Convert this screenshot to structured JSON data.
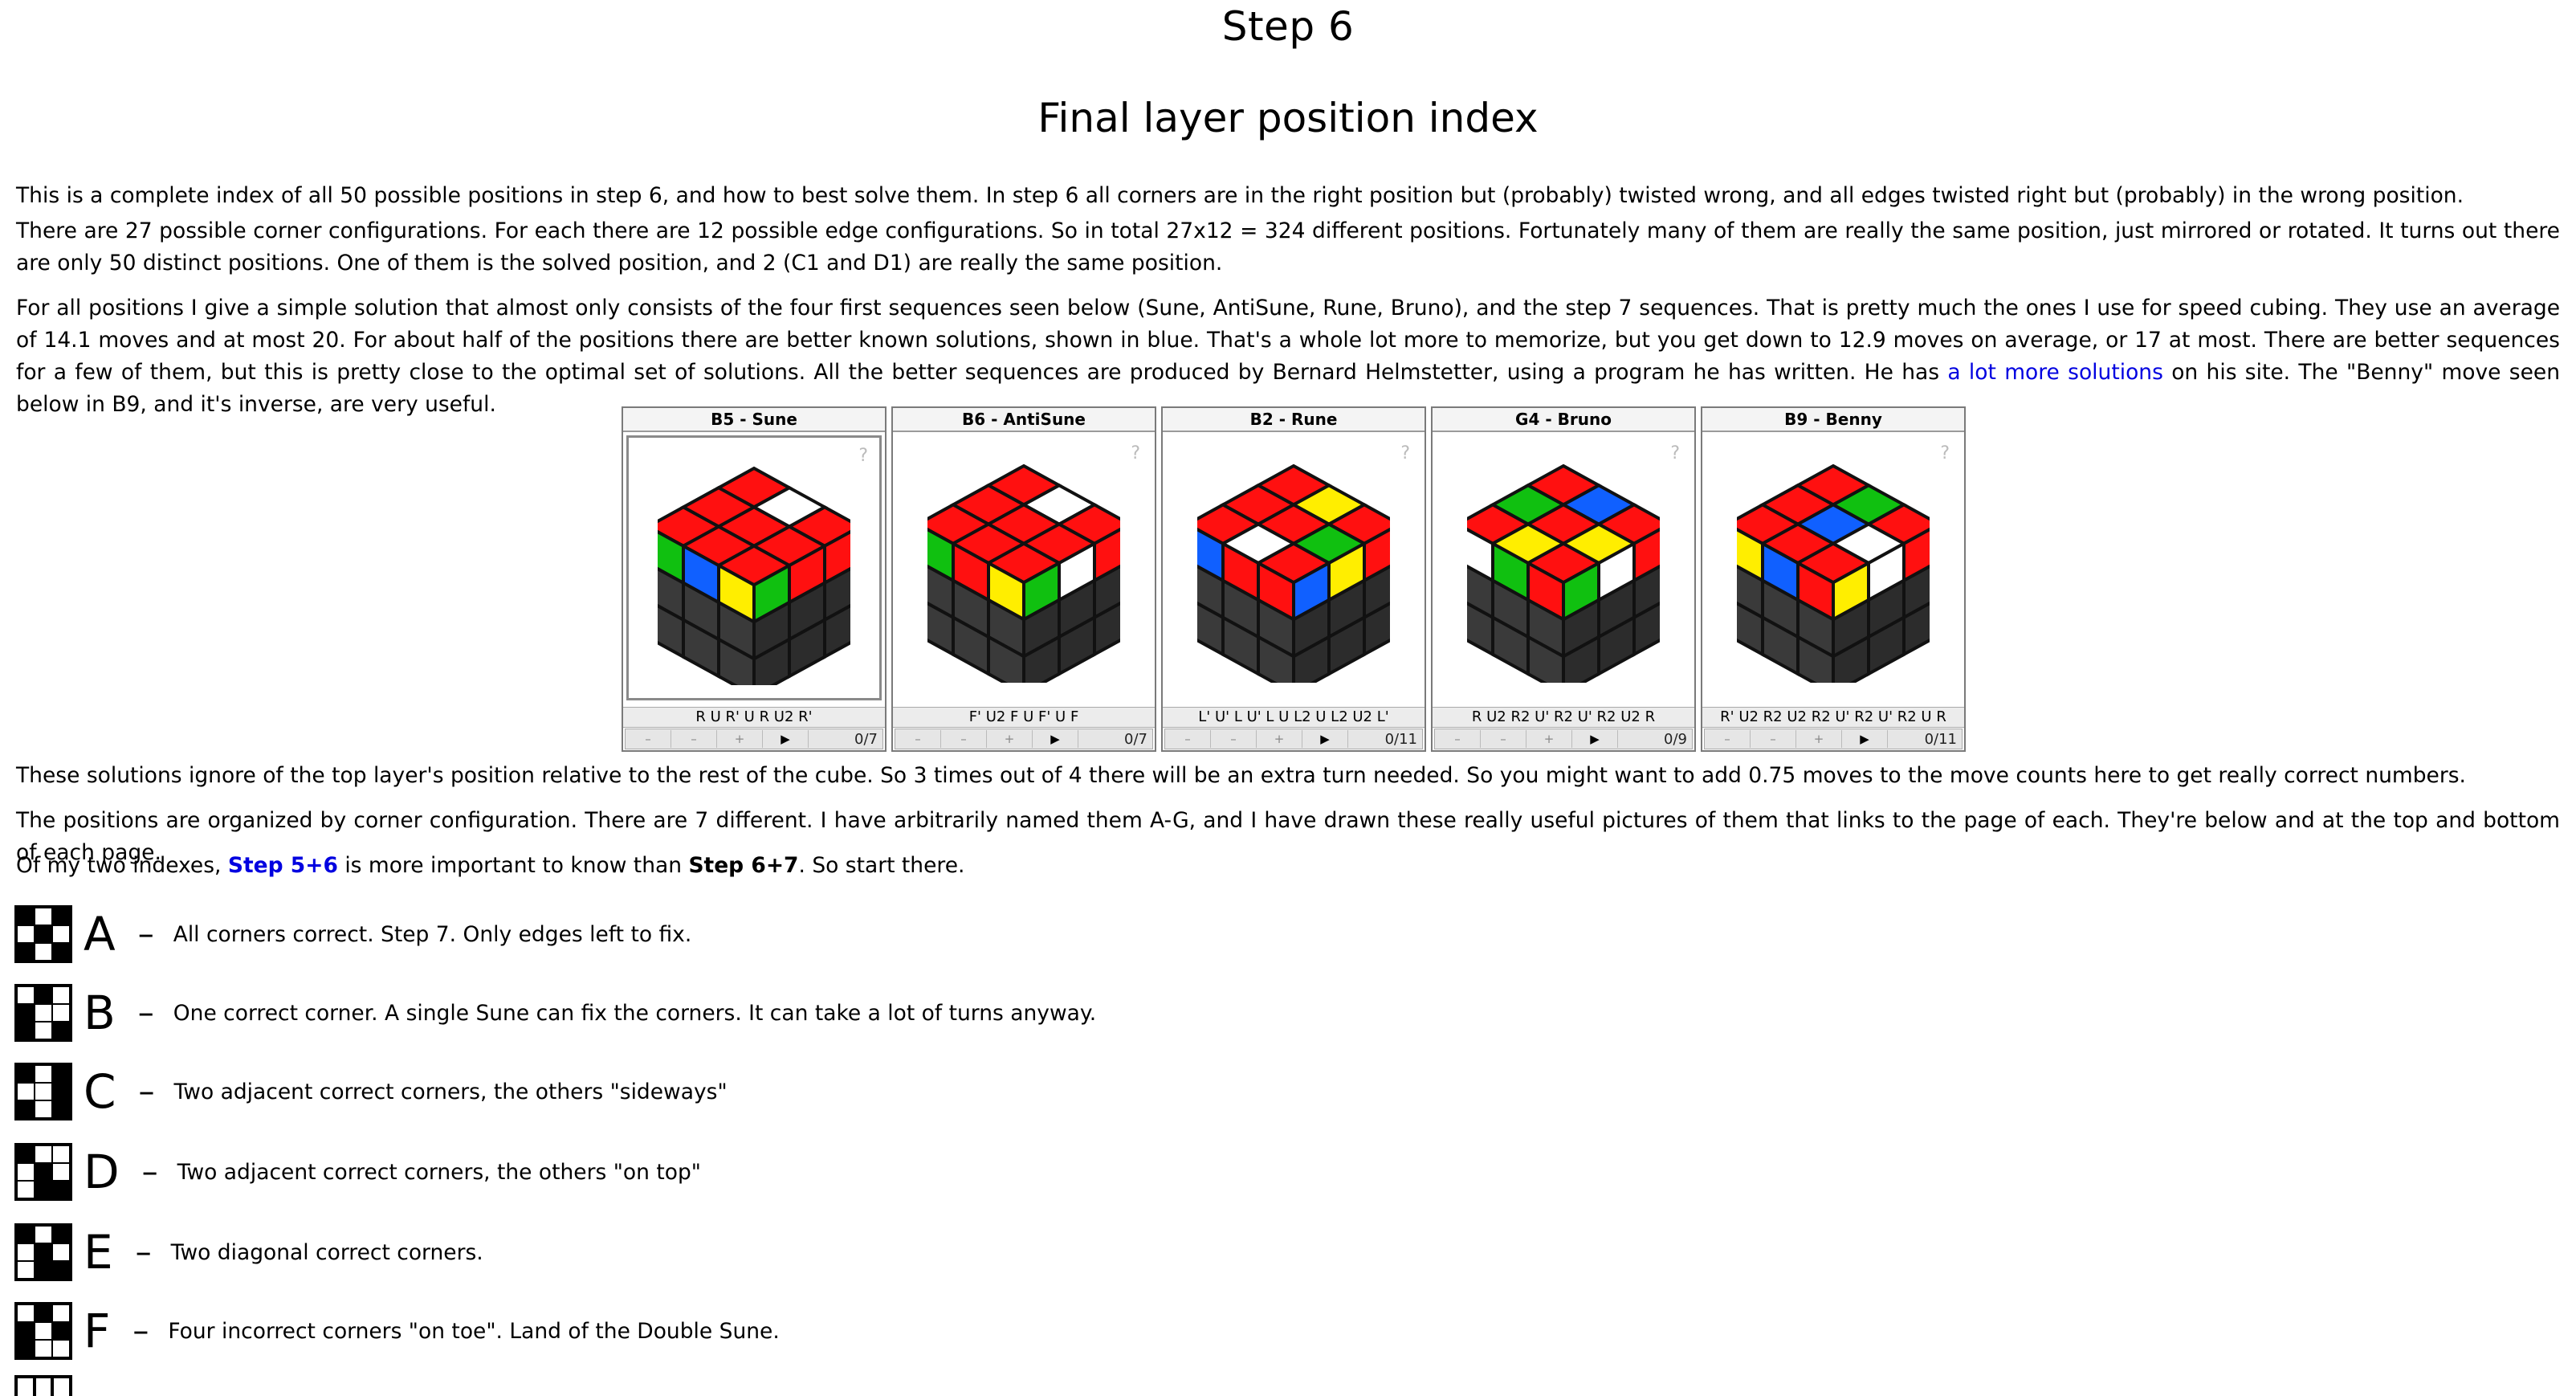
{
  "page": {
    "title": "Step 6",
    "subtitle": "Final layer position index"
  },
  "intro": {
    "p1": "This is a complete index of all 50 possible positions in step 6, and how to best solve them. In step 6 all corners are in the right position but (probably) twisted wrong, and all edges twisted right but (probably) in the wrong position.",
    "p2": "There are 27 possible corner configurations. For each there are 12 possible edge configurations. So in total 27x12 = 324 different positions. Fortunately many of them are really the same position, just mirrored or rotated. It turns out there are only 50 distinct positions. One of them is the solved position, and 2 (C1 and D1) are really the same position.",
    "p3_a": "For all positions I give a simple solution that almost only consists of the four first sequences seen below (Sune, AntiSune, Rune, Bruno), and the step 7 sequences. That is pretty much the ones I use for speed cubing. They use an average of 14.1 moves and at most 20. For about half of the positions there are better known solutions, shown in blue. That's a whole lot more to memorize, but you get down to 12.9 moves on average, or 17 at most. There are better sequences for a few of them, but this is pretty close to the optimal set of solutions. All the better sequences are produced by Bernard Helmstetter, using a program he has written. He has ",
    "p3_link": "a lot more solutions",
    "p3_b": " on his site. The \"Benny\" move seen below in B9, and it's inverse, are very useful."
  },
  "applets": [
    {
      "title": "B5 - Sune",
      "moves": "R U R' U R U2 R'",
      "counter": "0/7",
      "help": "?"
    },
    {
      "title": "B6 - AntiSune",
      "moves": "F' U2 F U F' U F",
      "counter": "0/7",
      "help": "?"
    },
    {
      "title": "B2 - Rune",
      "moves": "L' U' L U' L U L2 U L2 U2 L'",
      "counter": "0/11",
      "help": "?"
    },
    {
      "title": "G4 - Bruno",
      "moves": "R U2 R2 U' R2 U' R2 U2 R",
      "counter": "0/9",
      "help": "?"
    },
    {
      "title": "B9 - Benny",
      "moves": "R' U2 R2 U2 R2 U' R2 U' R2 U R",
      "counter": "0/11",
      "help": "?"
    }
  ],
  "applet_controls": [
    "–",
    "–",
    "+",
    "▶"
  ],
  "notes": {
    "p4": "These solutions ignore of the top layer's position relative to the rest of the cube. So 3 times out of 4 there will be an extra turn needed. So you might want to add 0.75 moves to the move counts here to get really correct numbers.",
    "p5": "The positions are organized by corner configuration. There are 7 different. I have arbitrarily named them A-G, and I have drawn these really useful pictures of them that links to the page of each. They're below and at the top and bottom of each page.",
    "p6_a": "Of my two indexes, ",
    "p6_link": "Step 5+6",
    "p6_b": " is more important to know than ",
    "p6_bold": "Step 6+7",
    "p6_c": ". So start there."
  },
  "categories": [
    {
      "letter": "A",
      "dash": "–",
      "desc": "All corners correct. Step 7. Only edges left to fix."
    },
    {
      "letter": "B",
      "dash": "–",
      "desc": "One correct corner. A single Sune can fix the corners. It can take a lot of turns anyway."
    },
    {
      "letter": "C",
      "dash": "–",
      "desc": "Two adjacent correct corners, the others \"sideways\""
    },
    {
      "letter": "D",
      "dash": "–",
      "desc": "Two adjacent correct corners, the others \"on top\""
    },
    {
      "letter": "E",
      "dash": "–",
      "desc": "Two diagonal correct corners."
    },
    {
      "letter": "F",
      "dash": "–",
      "desc": "Four incorrect corners \"on toe\". Land of the Double Sune."
    }
  ],
  "colors": {
    "link": "#0000e0",
    "cube_dark": "#3a3a3a",
    "red": "#ff1010",
    "green": "#10c010",
    "blue": "#1060ff",
    "yellow": "#ffee00",
    "white": "#ffffff"
  }
}
